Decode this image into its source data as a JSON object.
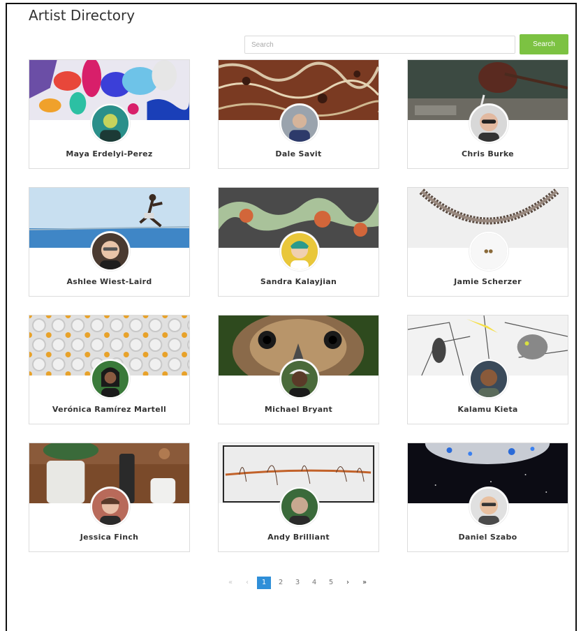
{
  "page": {
    "title": "Artist Directory"
  },
  "search": {
    "placeholder": "Search",
    "button_label": "Search"
  },
  "artists": [
    {
      "name": "Maya Erdelyi-Perez"
    },
    {
      "name": "Dale Savit"
    },
    {
      "name": "Chris Burke"
    },
    {
      "name": "Ashlee Wiest-Laird"
    },
    {
      "name": "Sandra Kalayjian"
    },
    {
      "name": "Jamie Scherzer"
    },
    {
      "name": "Verónica Ramírez Martell"
    },
    {
      "name": "Michael Bryant"
    },
    {
      "name": "Kalamu Kieta"
    },
    {
      "name": "Jessica Finch"
    },
    {
      "name": "Andy Brilliant"
    },
    {
      "name": "Daniel Szabo"
    }
  ],
  "pagination": {
    "first": "«",
    "prev": "‹",
    "pages": [
      "1",
      "2",
      "3",
      "4",
      "5"
    ],
    "current": "1",
    "next": "›",
    "last": "»"
  },
  "colors": {
    "accent_green": "#7cc242",
    "active_page": "#2f8fd8"
  }
}
